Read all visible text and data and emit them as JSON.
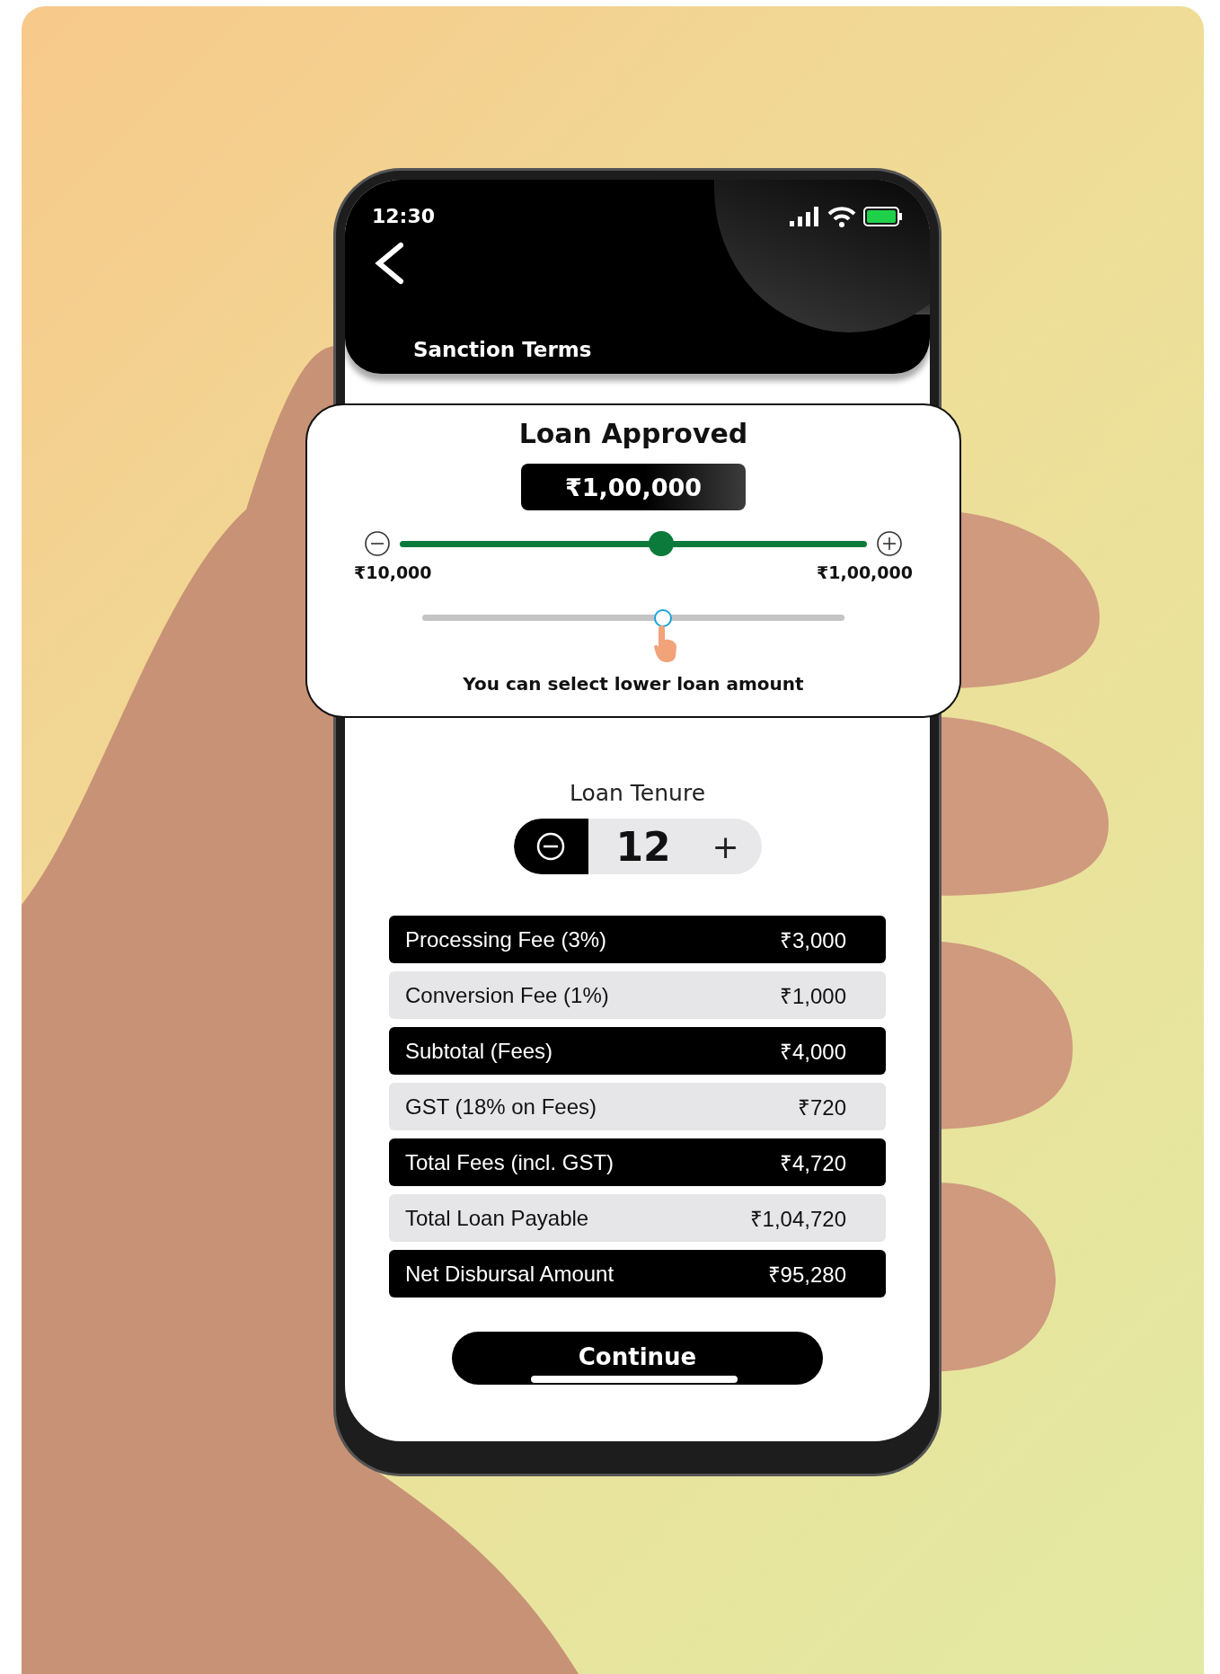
{
  "status_bar": {
    "time": "12:30"
  },
  "header": {
    "title": "Sanction Terms"
  },
  "loan_card": {
    "title": "Loan Approved",
    "amount": "₹1,00,000",
    "slider": {
      "level": 0.56,
      "min_label": "₹10,000",
      "max_label": "₹1,00,000"
    },
    "hint_slider": {
      "level": 0.57
    },
    "hint": "You can select lower loan amount"
  },
  "tenure": {
    "label": "Loan Tenure",
    "value": "12",
    "plus": "+"
  },
  "fees": [
    {
      "label": "Processing Fee (3%)",
      "value": "₹3,000",
      "kind": "dark"
    },
    {
      "label": "Conversion Fee (1%)",
      "value": "₹1,000",
      "kind": "light"
    },
    {
      "label": "Subtotal (Fees)",
      "value": "₹4,000",
      "kind": "dark"
    },
    {
      "label": "GST (18% on Fees)",
      "value": "₹720",
      "kind": "light"
    },
    {
      "label": "Total Fees (incl. GST)",
      "value": "₹4,720",
      "kind": "dark"
    },
    {
      "label": "Total Loan Payable",
      "value": "₹1,04,720",
      "kind": "light"
    },
    {
      "label": "Net Disbursal Amount",
      "value": "₹95,280",
      "kind": "dark"
    }
  ],
  "continue_button": "Continue"
}
